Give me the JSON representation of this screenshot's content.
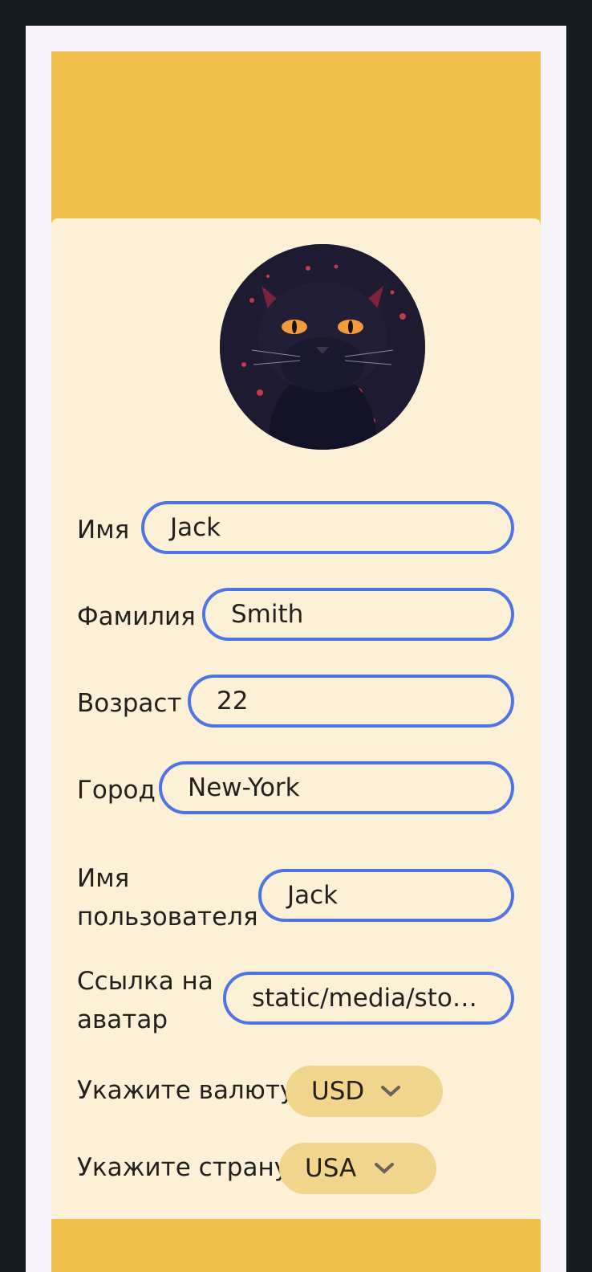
{
  "profile": {
    "avatar_icon": "cat-avatar",
    "fields": {
      "first_name": {
        "label": "Имя",
        "value": "Jack"
      },
      "last_name": {
        "label": "Фамилия",
        "value": "Smith"
      },
      "age": {
        "label": "Возраст",
        "value": "22"
      },
      "city": {
        "label": "Город",
        "value": "New-York"
      },
      "username": {
        "label_line1": "Имя",
        "label_line2": "пользователя",
        "value": "Jack"
      },
      "avatar_link": {
        "label_line1": "Ссылка на",
        "label_line2": "аватар",
        "value": "static/media/storyb..."
      }
    },
    "currency": {
      "label": "Укажите валюту",
      "value": "USD"
    },
    "country": {
      "label": "Укажите страну",
      "value": "USA"
    }
  },
  "colors": {
    "banner": "#efc14c",
    "card": "#fcf1d7",
    "input_border": "#4f74e3",
    "select_bg": "#f0d68c",
    "page_bg": "#141b1f"
  }
}
